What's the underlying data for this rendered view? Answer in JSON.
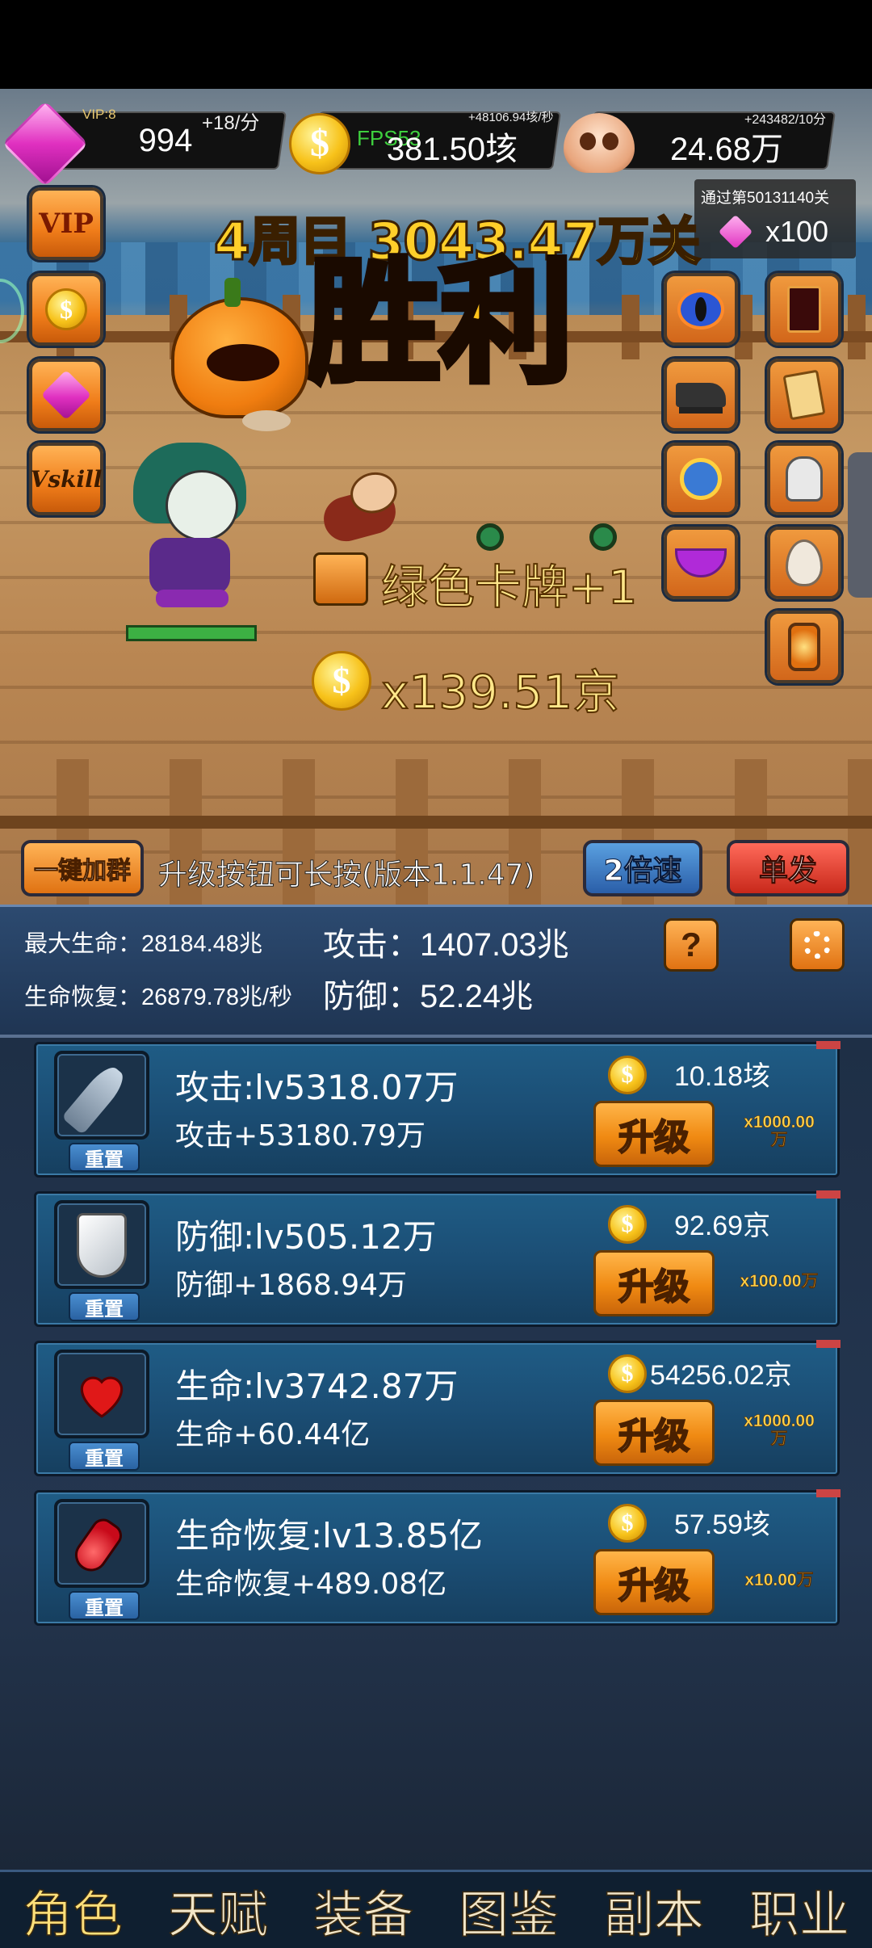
{
  "hud": {
    "vip_label": "VIP:8",
    "gem_rate": "+18/分",
    "gems": "994",
    "fps": "FPS53",
    "gold_rate": "+48106.94垓/秒",
    "gold": "381.50垓",
    "skull_rate": "+243482/10分",
    "skulls": "24.68万"
  },
  "stage_reward": {
    "label": "通过第50131140关",
    "amount": "x100"
  },
  "battle": {
    "round_title": "4周目 3043.47万关",
    "result": "胜利",
    "card_drop": "绿色卡牌+1",
    "gold_drop": "x139.51京"
  },
  "side_buttons": {
    "vip": "VIP",
    "vskill": "Vskill"
  },
  "action_bar": {
    "join_group": "一键加群",
    "hint": "升级按钮可长按(版本1.1.47)",
    "speed": "2倍速",
    "mode": "单发"
  },
  "stats": {
    "max_hp": "最大生命：28184.48兆",
    "regen": "生命恢复：26879.78兆/秒",
    "attack": "攻击：1407.03兆",
    "defense": "防御：52.24兆",
    "help": "?"
  },
  "upgrades": [
    {
      "title": "攻击:lv5318.07万",
      "bonus": "攻击+53180.79万",
      "cost": "10.18垓",
      "button": "升级",
      "mult_line1": "x1000.00",
      "mult_line2": "万",
      "reset": "重置",
      "icon": "dagger-icon"
    },
    {
      "title": "防御:lv505.12万",
      "bonus": "防御+1868.94万",
      "cost": "92.69京",
      "button": "升级",
      "mult_line1": "x100.00万",
      "mult_line2": "",
      "reset": "重置",
      "icon": "shield-icon"
    },
    {
      "title": "生命:lv3742.87万",
      "bonus": "生命+60.44亿",
      "cost": "54256.02京",
      "button": "升级",
      "mult_line1": "x1000.00",
      "mult_line2": "万",
      "reset": "重置",
      "icon": "heart-icon"
    },
    {
      "title": "生命恢复:lv13.85亿",
      "bonus": "生命恢复+489.08亿",
      "cost": "57.59垓",
      "button": "升级",
      "mult_line1": "x10.00万",
      "mult_line2": "",
      "reset": "重置",
      "icon": "potion-icon"
    }
  ],
  "nav": [
    "角色",
    "天赋",
    "装备",
    "图鉴",
    "副本",
    "职业"
  ],
  "colors": {
    "gold": "#ffc21a",
    "orange_button": "#f08a12",
    "panel_blue": "#1f5c85"
  }
}
